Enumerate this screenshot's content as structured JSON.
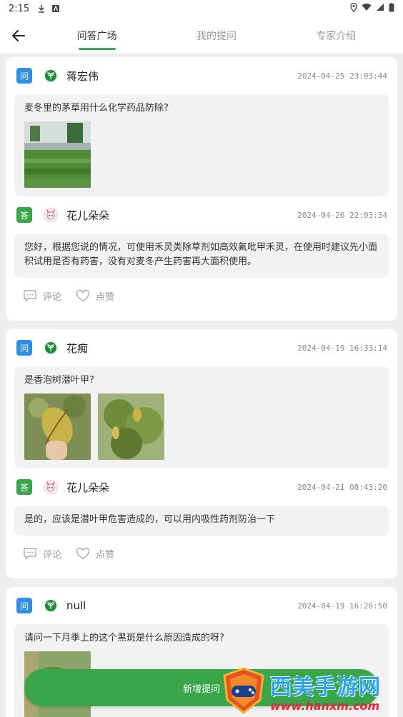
{
  "status_bar": {
    "time": "2:15"
  },
  "nav": {
    "tabs": [
      {
        "label": "问答广场",
        "active": true
      },
      {
        "label": "我的提问",
        "active": false
      },
      {
        "label": "专家介绍",
        "active": false
      }
    ]
  },
  "badges": {
    "question": "问",
    "answer": "答"
  },
  "actions": {
    "comment": "评论",
    "like": "点赞"
  },
  "posts": [
    {
      "question": {
        "user": "蒋宏伟",
        "time": "2024-04-25 23:03:44",
        "text": "麦冬里的茅草用什么化学药品防除?"
      },
      "answer": {
        "user": "花儿朵朵",
        "time": "2024-04-26 22:03:34",
        "text": "您好，根据您说的情况，可使用禾灵类除草剂如高效氟吡甲禾灵，在使用时建议先小面积试用是否有药害，没有对麦冬产生药害再大面积使用。"
      }
    },
    {
      "question": {
        "user": "花痴",
        "time": "2024-04-19 16:33:14",
        "text": "是香泡树潜叶甲?"
      },
      "answer": {
        "user": "花儿朵朵",
        "time": "2024-04-21 08:43:20",
        "text": "是的，应该是潜叶甲危害造成的，可以用内吸性药剂防治一下"
      }
    },
    {
      "question": {
        "user": "null",
        "time": "2024-04-19 16:26:50",
        "text": "请问一下月季上的这个黑斑是什么原因造成的呀?"
      }
    }
  ],
  "add_button": {
    "label": "新增提问"
  },
  "watermark": {
    "title": "西美手游网",
    "url": "www.hanxm.com"
  },
  "colors": {
    "accent": "#3aa64a",
    "question_badge": "#2f8ee8",
    "answer_badge": "#3aa64a"
  }
}
